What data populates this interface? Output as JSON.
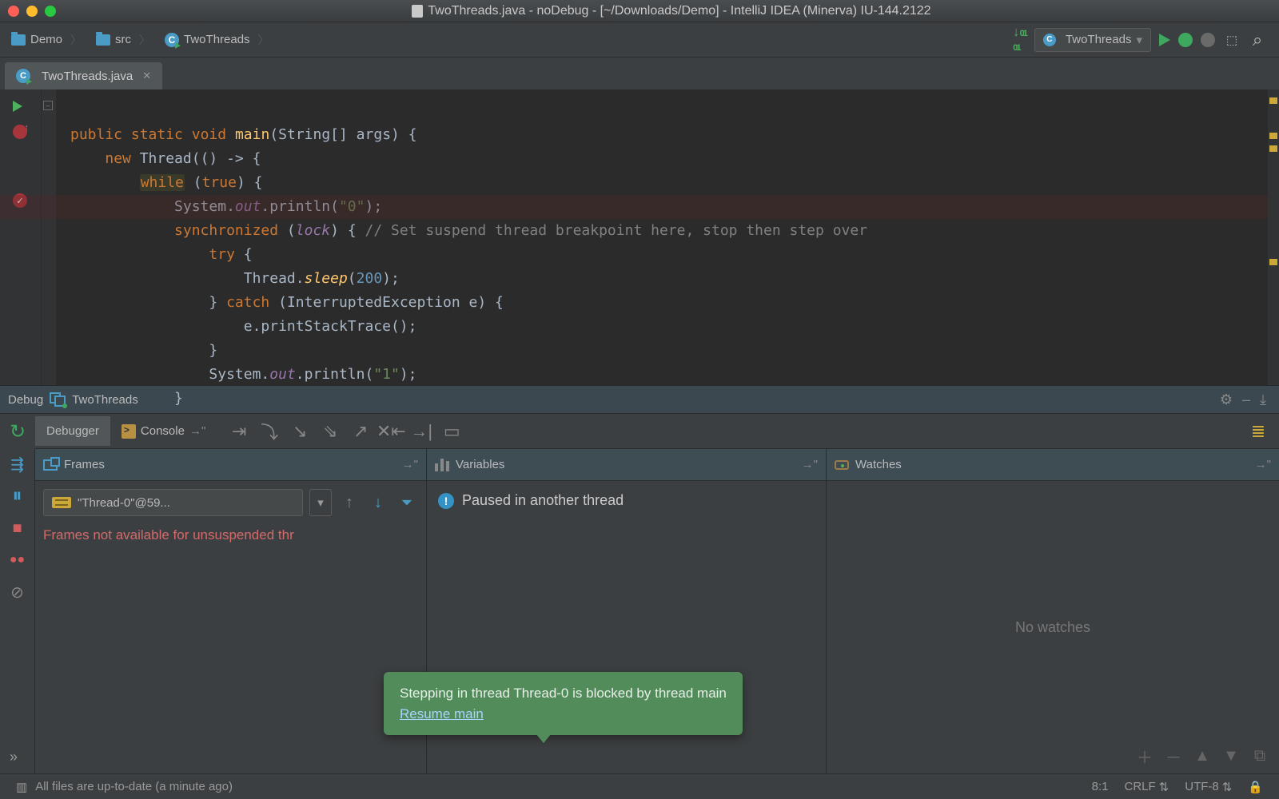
{
  "window": {
    "title": "TwoThreads.java - noDebug - [~/Downloads/Demo] - IntelliJ IDEA (Minerva) IU-144.2122"
  },
  "breadcrumbs": {
    "project": "Demo",
    "folder": "src",
    "class": "TwoThreads"
  },
  "runconfig": {
    "name": "TwoThreads"
  },
  "tab": {
    "file": "TwoThreads.java"
  },
  "code": {
    "l1a": "public",
    "l1b": "static",
    "l1c": "void",
    "l1d": "main",
    "l1e": "(String[] args) {",
    "l2a": "new",
    "l2b": " Thread(() -> {",
    "l3a": "while",
    "l3b": " (",
    "l3c": "true",
    "l3d": ") {",
    "l4a": "            System.",
    "l4b": "out",
    "l4c": ".println(",
    "l4d": "\"0\"",
    "l4e": ");",
    "l5a": "synchronized",
    "l5b": " (",
    "l5c": "lock",
    "l5d": ") { ",
    "l5e": "// Set suspend thread breakpoint here, stop then step over",
    "l6a": "try",
    "l6b": " {",
    "l7a": "                    Thread.",
    "l7b": "sleep",
    "l7c": "(",
    "l7d": "200",
    "l7e": ");",
    "l8a": "                } ",
    "l8b": "catch",
    "l8c": " (InterruptedException e) {",
    "l9": "                    e.printStackTrace();",
    "l10": "                }",
    "l11a": "                System.",
    "l11b": "out",
    "l11c": ".println(",
    "l11d": "\"1\"",
    "l11e": ");",
    "l12": "            }"
  },
  "debug": {
    "title": "Debug",
    "config": "TwoThreads",
    "tab_debugger": "Debugger",
    "tab_console": "Console"
  },
  "frames": {
    "title": "Frames",
    "thread": "\"Thread-0\"@59...",
    "message": "Frames not available for unsuspended thr"
  },
  "variables": {
    "title": "Variables",
    "message": "Paused in another thread"
  },
  "watches": {
    "title": "Watches",
    "empty": "No watches"
  },
  "tooltip": {
    "line1": "Stepping in thread Thread-0 is blocked by thread main",
    "link": "Resume main"
  },
  "status": {
    "msg": "All files are up-to-date (a minute ago)",
    "pos": "8:1",
    "line_sep": "CRLF",
    "encoding": "UTF-8"
  }
}
